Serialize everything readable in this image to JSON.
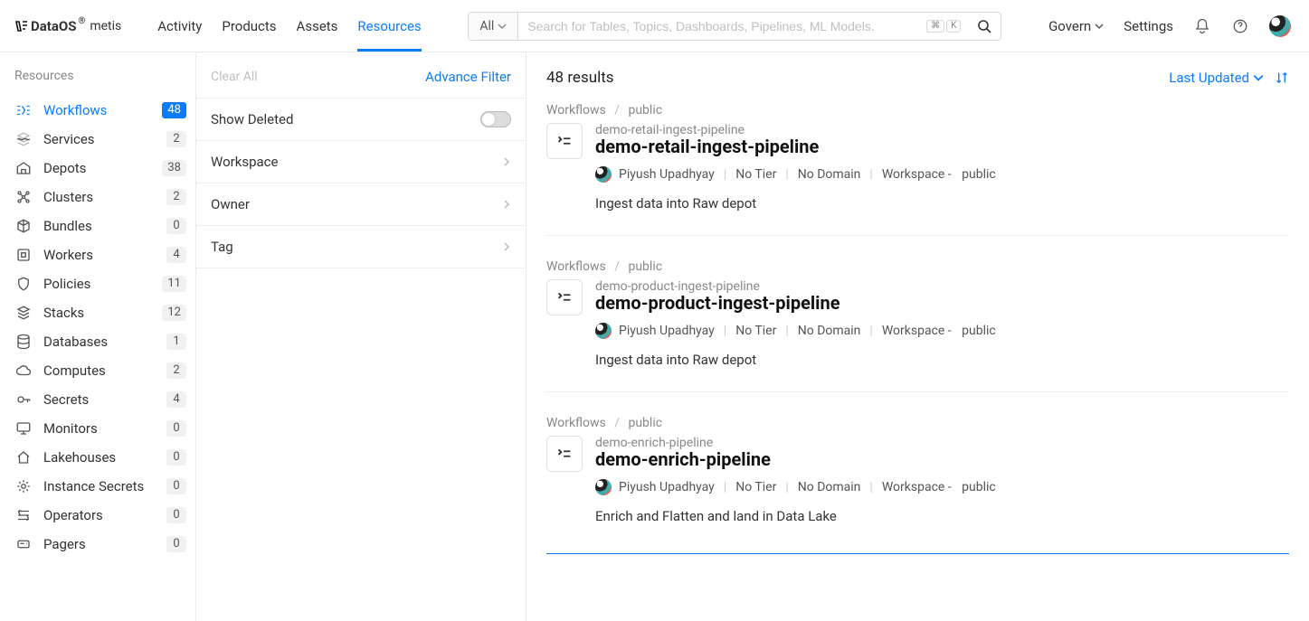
{
  "logo": {
    "brand": "DataOS",
    "sub": "metis"
  },
  "topNav": [
    {
      "label": "Activity"
    },
    {
      "label": "Products"
    },
    {
      "label": "Assets"
    },
    {
      "label": "Resources",
      "active": true
    }
  ],
  "search": {
    "selector": "All",
    "placeholder": "Search for Tables, Topics, Dashboards, Pipelines, ML Models.",
    "kbd1": "⌘",
    "kbd2": "K"
  },
  "headerRight": {
    "govern": "Govern",
    "settings": "Settings"
  },
  "sidebar": {
    "title": "Resources",
    "items": [
      {
        "label": "Workflows",
        "count": "48",
        "active": true
      },
      {
        "label": "Services",
        "count": "2"
      },
      {
        "label": "Depots",
        "count": "38"
      },
      {
        "label": "Clusters",
        "count": "2"
      },
      {
        "label": "Bundles",
        "count": "0"
      },
      {
        "label": "Workers",
        "count": "4"
      },
      {
        "label": "Policies",
        "count": "11"
      },
      {
        "label": "Stacks",
        "count": "12"
      },
      {
        "label": "Databases",
        "count": "1"
      },
      {
        "label": "Computes",
        "count": "2"
      },
      {
        "label": "Secrets",
        "count": "4"
      },
      {
        "label": "Monitors",
        "count": "0"
      },
      {
        "label": "Lakehouses",
        "count": "0"
      },
      {
        "label": "Instance Secrets",
        "count": "0"
      },
      {
        "label": "Operators",
        "count": "0"
      },
      {
        "label": "Pagers",
        "count": "0"
      }
    ]
  },
  "filter": {
    "clearAll": "Clear All",
    "advance": "Advance Filter",
    "showDeleted": "Show Deleted",
    "groups": [
      {
        "label": "Workspace"
      },
      {
        "label": "Owner"
      },
      {
        "label": "Tag"
      }
    ]
  },
  "results": {
    "count": "48 results",
    "sort": "Last Updated",
    "cards": [
      {
        "crumbType": "Workflows",
        "crumbScope": "public",
        "slug": "demo-retail-ingest-pipeline",
        "title": "demo-retail-ingest-pipeline",
        "owner": "Piyush Upadhyay",
        "tier": "No Tier",
        "domain": "No Domain",
        "wsLabel": "Workspace -",
        "wsValue": "public",
        "desc": "Ingest data into Raw depot"
      },
      {
        "crumbType": "Workflows",
        "crumbScope": "public",
        "slug": "demo-product-ingest-pipeline",
        "title": "demo-product-ingest-pipeline",
        "owner": "Piyush Upadhyay",
        "tier": "No Tier",
        "domain": "No Domain",
        "wsLabel": "Workspace -",
        "wsValue": "public",
        "desc": "Ingest data into Raw depot"
      },
      {
        "crumbType": "Workflows",
        "crumbScope": "public",
        "slug": "demo-enrich-pipeline",
        "title": "demo-enrich-pipeline",
        "owner": "Piyush Upadhyay",
        "tier": "No Tier",
        "domain": "No Domain",
        "wsLabel": "Workspace -",
        "wsValue": "public",
        "desc": "Enrich and Flatten and land in Data Lake"
      }
    ]
  }
}
